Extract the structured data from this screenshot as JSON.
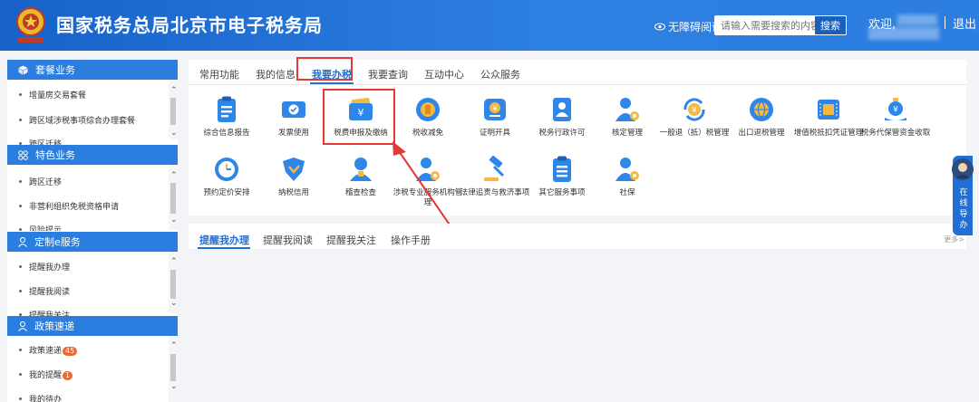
{
  "header": {
    "title": "国家税务总局北京市电子税务局",
    "accessibility_label": "无障碍阅读",
    "search_placeholder": "请输入需要搜索的内容",
    "search_button": "搜索",
    "welcome": "欢迎,",
    "logout": "退出"
  },
  "sidebar": {
    "sections": [
      {
        "title": "套餐业务",
        "icon": "cube-icon",
        "items": [
          "增量房交易套餐",
          "跨区域涉税事项综合办理套餐",
          "跨区迁移"
        ]
      },
      {
        "title": "特色业务",
        "icon": "grid-icon",
        "items": [
          "跨区迁移",
          "非营利组织免税资格申请",
          "风险提示"
        ]
      },
      {
        "title": "定制e服务",
        "icon": "user-icon",
        "items": [
          "提醒我办理",
          "提醒我阅读",
          "提醒我关注"
        ]
      },
      {
        "title": "政策速递",
        "icon": "user-icon",
        "items": [
          "政策速递",
          "我的提醒",
          "我的待办"
        ],
        "badges": [
          "45",
          "1",
          ""
        ]
      }
    ]
  },
  "main": {
    "tabs": [
      "常用功能",
      "我的信息",
      "我要办税",
      "我要查询",
      "互动中心",
      "公众服务"
    ],
    "active_tab": "我要办税",
    "services": [
      {
        "label": "综合信息报告",
        "icon": "report-icon"
      },
      {
        "label": "发票使用",
        "icon": "invoice-icon"
      },
      {
        "label": "税费申报及缴纳",
        "icon": "wallet-icon"
      },
      {
        "label": "税收减免",
        "icon": "coin-icon"
      },
      {
        "label": "证明开具",
        "icon": "certificate-icon"
      },
      {
        "label": "税务行政许可",
        "icon": "person-card-icon"
      },
      {
        "label": "核定管理",
        "icon": "person-gear-icon"
      },
      {
        "label": "一般退（抵）税管理",
        "icon": "refund-icon"
      },
      {
        "label": "出口退税管理",
        "icon": "globe-icon"
      },
      {
        "label": "增值税抵扣凭证管理",
        "icon": "ticket-icon"
      },
      {
        "label": "税务代保管资金收取",
        "icon": "money-bag-icon"
      },
      {
        "label": "预约定价安排",
        "icon": "clock-icon"
      },
      {
        "label": "纳税信用",
        "icon": "shield-check-icon"
      },
      {
        "label": "稽查检查",
        "icon": "inspector-icon"
      },
      {
        "label": "涉税专业服务机构管理",
        "icon": "person-gear-icon"
      },
      {
        "label": "法律追责与救济事项",
        "icon": "gavel-icon"
      },
      {
        "label": "其它服务事项",
        "icon": "list-icon"
      },
      {
        "label": "社保",
        "icon": "person-gear-icon"
      }
    ]
  },
  "reminders": {
    "tabs": [
      "提醒我办理",
      "提醒我阅读",
      "提醒我关注",
      "操作手册"
    ],
    "active_tab": "提醒我办理",
    "more": "更多>"
  },
  "float_help": {
    "label": "在线导办"
  },
  "colors": {
    "primary": "#1f6fd6",
    "header": "#1662c9",
    "highlight": "#e53935"
  }
}
